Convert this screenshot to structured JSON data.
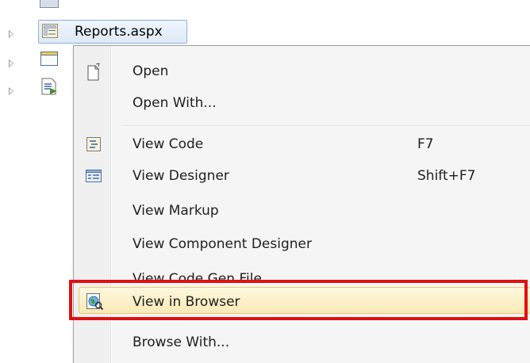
{
  "tree": {
    "selected_file": "Reports.aspx",
    "cut_row_text": "▬ ▬▬▬ ▬ ▬▬▬▬ ▬"
  },
  "context_menu": {
    "items": [
      {
        "label": "Open",
        "shortcut": "",
        "icon": "open-file-icon"
      },
      {
        "label": "Open With...",
        "shortcut": "",
        "icon": ""
      },
      {
        "label": "View Code",
        "shortcut": "F7",
        "icon": "view-code-icon"
      },
      {
        "label": "View Designer",
        "shortcut": "Shift+F7",
        "icon": "view-designer-icon"
      },
      {
        "label": "View Markup",
        "shortcut": "",
        "icon": ""
      },
      {
        "label": "View Component Designer",
        "shortcut": "",
        "icon": ""
      },
      {
        "label": "View Code Gen File",
        "shortcut": "",
        "icon": ""
      },
      {
        "label": "View in Browser",
        "shortcut": "",
        "icon": "browser-icon",
        "highlighted": true
      }
    ],
    "next_item_partial": "Browse With..."
  },
  "colors": {
    "highlight_border": "#e01010",
    "hover_fill": "#f9e9b6",
    "selection_fill": "#dfeaf8"
  }
}
